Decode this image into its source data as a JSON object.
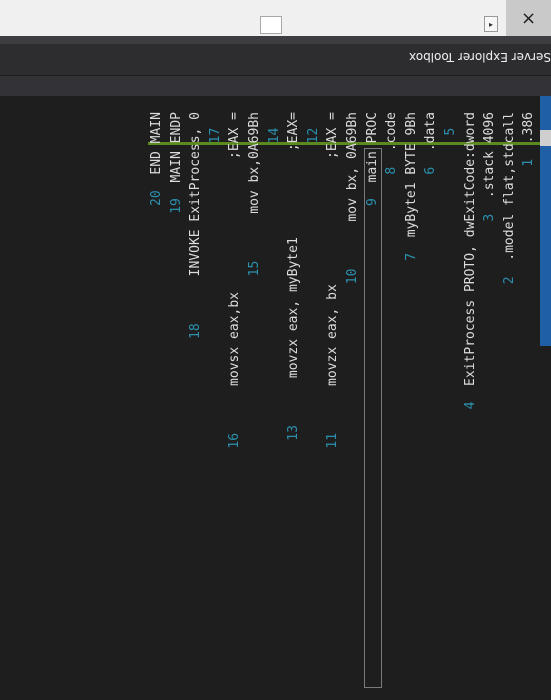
{
  "chrome": {
    "close_icon": "close-icon",
    "close_glyph": "×",
    "arrow_glyph": "▸"
  },
  "tabs": {
    "toolbox": "Toolbox",
    "server_explorer": "Server Explorer"
  },
  "editor": {
    "lines": [
      {
        "n": "1",
        "text": ".386"
      },
      {
        "n": "2",
        "text": ".model flat,stdcall"
      },
      {
        "n": "3",
        "text": ".stack 4096"
      },
      {
        "n": "4",
        "text": "ExitProcess PROTO, dwExitCode:dword"
      },
      {
        "n": "5",
        "text": ""
      },
      {
        "n": "6",
        "text": ".data"
      },
      {
        "n": "7",
        "text": "myByte1 BYTE 9Bh"
      },
      {
        "n": "8",
        "text": ".code"
      },
      {
        "n": "9",
        "text": "main PROC"
      },
      {
        "n": "10",
        "text": "    mov bx, 0A69Bh"
      },
      {
        "n": "11",
        "text": "    movzx eax, bx                ;EAX ="
      },
      {
        "n": "12",
        "text": ""
      },
      {
        "n": "13",
        "text": "    movzx eax, myByte1           ;EAX="
      },
      {
        "n": "14",
        "text": ""
      },
      {
        "n": "15",
        "text": "    mov bx,0A69Bh"
      },
      {
        "n": "16",
        "text": "    movsx eax,bx                 ;EAX ="
      },
      {
        "n": "17",
        "text": ""
      },
      {
        "n": "18",
        "text": "    INVOKE ExitProcess, 0"
      },
      {
        "n": "19",
        "text": "MAIN ENDP"
      },
      {
        "n": "20",
        "text": "END MAIN"
      }
    ]
  }
}
